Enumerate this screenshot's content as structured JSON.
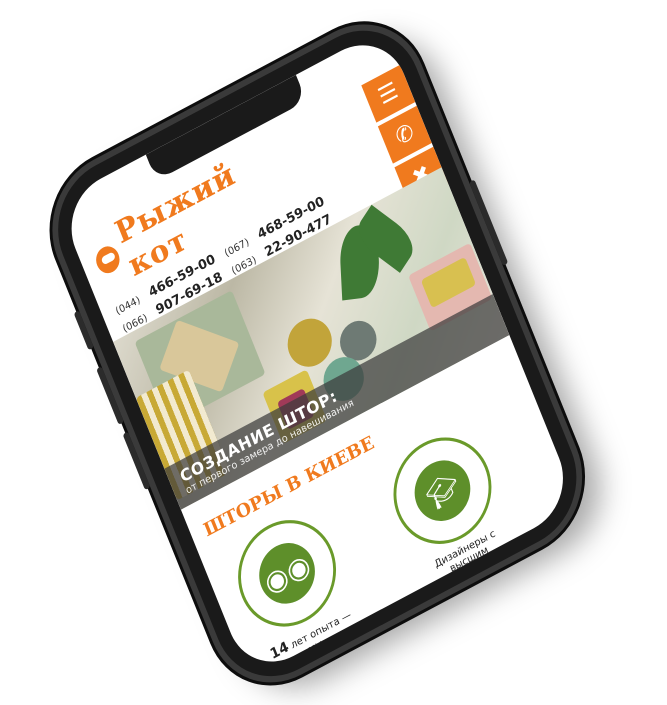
{
  "site": {
    "logo_text": "Рыжий кот",
    "phones": [
      {
        "code": "(044)",
        "number": "466-59-00"
      },
      {
        "code": "(067)",
        "number": "468-59-00"
      },
      {
        "code": "(066)",
        "number": "907-69-18"
      },
      {
        "code": "(063)",
        "number": "22-90-477"
      }
    ],
    "menu_icons": [
      "menu-icon",
      "callback-icon",
      "tools-icon"
    ],
    "accent_color": "#f07a1e",
    "green_color": "#6a9a2a"
  },
  "hero": {
    "title": "СОЗДАНИЕ ШТОР:",
    "subtitle": "от первого замера до навешивания"
  },
  "section": {
    "title": "ШТОРЫ В КИЕВЕ"
  },
  "features": [
    {
      "icon": "owl-icon",
      "number": "14",
      "text": "лет опыта — мы"
    },
    {
      "icon": "graduation-cap-icon",
      "number": "",
      "text": "Дизайнеры с высшим"
    }
  ]
}
